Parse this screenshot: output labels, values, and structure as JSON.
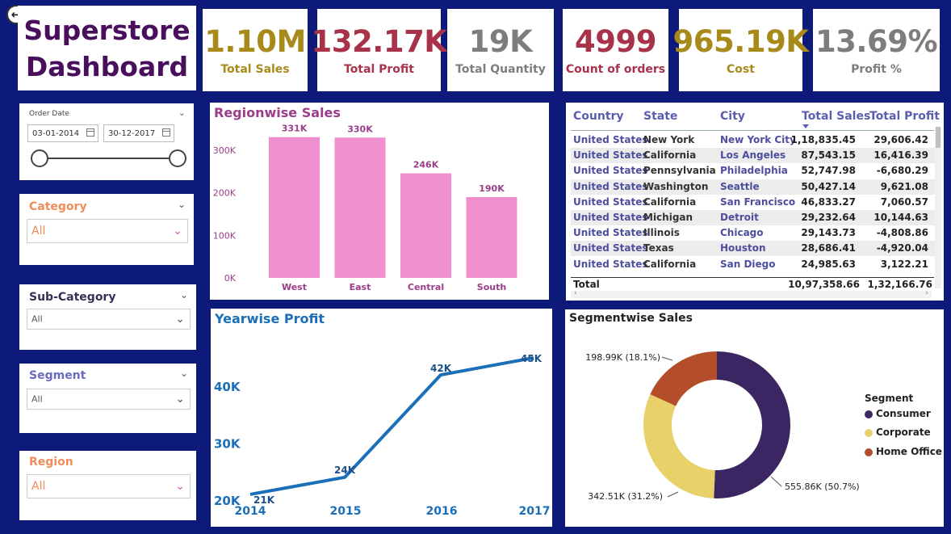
{
  "dashboard": {
    "title_line1": "Superstore",
    "title_line2": "Dashboard"
  },
  "kpis": [
    {
      "value": "1.10M",
      "label": "Total Sales",
      "color": "#a88a1a"
    },
    {
      "value": "132.17K",
      "label": "Total Profit",
      "color": "#a8324a"
    },
    {
      "value": "19K",
      "label": "Total Quantity",
      "color": "#7d7d7d"
    },
    {
      "value": "4999",
      "label": "Count of orders",
      "color": "#a8324a"
    },
    {
      "value": "965.19K",
      "label": "Cost",
      "color": "#a88a1a"
    },
    {
      "value": "13.69%",
      "label": "Profit %",
      "color": "#7d7d7d"
    }
  ],
  "filters": {
    "order_date": {
      "title": "Order Date",
      "start": "03-01-2014",
      "end": "30-12-2017"
    },
    "category": {
      "title": "Category",
      "value": "All",
      "color": "#f08c5a"
    },
    "sub_category": {
      "title": "Sub-Category",
      "value": "All",
      "color": "#333355"
    },
    "segment": {
      "title": "Segment",
      "value": "All",
      "color": "#6a6abf"
    },
    "region": {
      "title": "Region",
      "value": "All",
      "color": "#f08c5a"
    }
  },
  "icons": {
    "back": "back-arrow-icon",
    "calendar": "calendar-icon",
    "chevron": "chevron-down-icon"
  },
  "table": {
    "headers": [
      "Country",
      "State",
      "City",
      "Total Sales",
      "Total Profit"
    ],
    "rows": [
      [
        "United States",
        "New York",
        "New York City",
        "1,18,835.45",
        "29,606.42"
      ],
      [
        "United States",
        "California",
        "Los Angeles",
        "87,543.15",
        "16,416.39"
      ],
      [
        "United States",
        "Pennsylvania",
        "Philadelphia",
        "52,747.98",
        "-6,680.29"
      ],
      [
        "United States",
        "Washington",
        "Seattle",
        "50,427.14",
        "9,621.08"
      ],
      [
        "United States",
        "California",
        "San Francisco",
        "46,833.27",
        "7,060.57"
      ],
      [
        "United States",
        "Michigan",
        "Detroit",
        "29,232.64",
        "10,144.63"
      ],
      [
        "United States",
        "Illinois",
        "Chicago",
        "29,143.73",
        "-4,808.86"
      ],
      [
        "United States",
        "Texas",
        "Houston",
        "28,686.41",
        "-4,920.04"
      ],
      [
        "United States",
        "California",
        "San Diego",
        "24,985.63",
        "3,122.21"
      ]
    ],
    "total_label": "Total",
    "total_sales": "10,97,358.66",
    "total_profit": "1,32,166.76",
    "sorted_by": "Total Sales"
  },
  "chart_data": [
    {
      "type": "bar",
      "title": "Regionwise Sales",
      "categories": [
        "West",
        "East",
        "Central",
        "South"
      ],
      "values": [
        331000,
        330000,
        246000,
        190000
      ],
      "data_labels": [
        "331K",
        "330K",
        "246K",
        "190K"
      ],
      "y_ticks": [
        "0K",
        "100K",
        "200K",
        "300K"
      ],
      "ylim": [
        0,
        340000
      ],
      "color": "#ef8fce"
    },
    {
      "type": "line",
      "title": "Yearwise Profit",
      "x": [
        "2014",
        "2015",
        "2016",
        "2017"
      ],
      "values": [
        21000,
        24000,
        42000,
        45000
      ],
      "data_labels": [
        "21K",
        "24K",
        "42K",
        "45K"
      ],
      "y_ticks": [
        "20K",
        "30K",
        "40K"
      ],
      "ylim": [
        20000,
        45000
      ],
      "color": "#1a6fb8"
    },
    {
      "type": "pie",
      "title": "Segmentwise Sales",
      "legend_title": "Segment",
      "legend_position": "right",
      "series": [
        {
          "name": "Consumer",
          "value": 555.86,
          "label": "555.86K (50.7%)",
          "color": "#3b2663"
        },
        {
          "name": "Corporate",
          "value": 342.51,
          "label": "342.51K (31.2%)",
          "color": "#e8d168"
        },
        {
          "name": "Home Office",
          "value": 198.99,
          "label": "198.99K (18.1%)",
          "color": "#b44e2a"
        }
      ]
    }
  ]
}
